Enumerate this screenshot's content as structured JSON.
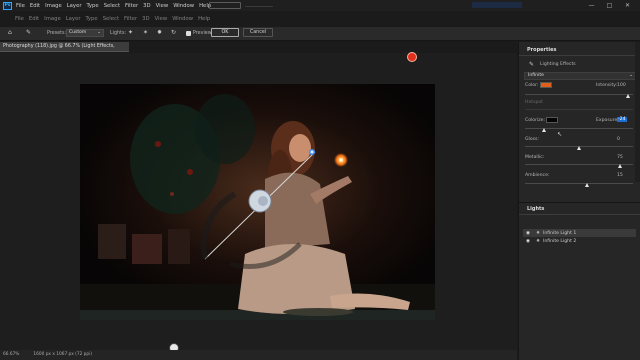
{
  "menubar": {
    "logo": "Ps",
    "items": [
      "File",
      "Edit",
      "Image",
      "Layer",
      "Type",
      "Select",
      "Filter",
      "3D",
      "View",
      "Window",
      "Help"
    ]
  },
  "window_controls": {
    "minimize": "—",
    "maximize": "□",
    "close": "✕"
  },
  "options": {
    "presets_label": "Presets:",
    "preset_value": "Custom",
    "lights_label": "Lights:",
    "preview_label": "Preview",
    "ok_label": "OK",
    "cancel_label": "Cancel"
  },
  "document": {
    "tab_title": "Photography (118).jpg @ 66.7% (Light Effects, RGB/8) *",
    "zoom": "66.67%",
    "doc_info": "1600 px x 1067 px (72 ppi)"
  },
  "properties": {
    "panel_title": "Properties",
    "effect_name": "Lighting Effects",
    "light_type": "Infinite",
    "color_label": "Color:",
    "color_value": "#e0601a",
    "intensity_label": "Intensity:",
    "intensity_value": "100",
    "intensity_level": 0.96,
    "hotspot_label": "Hotspot",
    "colorize_label": "Colorize:",
    "colorize_value": "#050505",
    "exposure_label": "Exposure:",
    "exposure_value": "-24",
    "exposure_level": 0.18,
    "gloss_label": "Gloss:",
    "gloss_value": "0",
    "gloss_level": 0.5,
    "metallic_label": "Metallic:",
    "metallic_value": "75",
    "metallic_level": 0.88,
    "ambience_label": "Ambience:",
    "ambience_value": "15",
    "ambience_level": 0.58
  },
  "lights": {
    "panel_title": "Lights",
    "items": [
      {
        "name": "Infinite Light 1",
        "selected": true
      },
      {
        "name": "Infinite Light 2",
        "selected": false
      }
    ]
  },
  "colors": {
    "accent": "#31a8ff",
    "light_color": "#e0601a"
  }
}
